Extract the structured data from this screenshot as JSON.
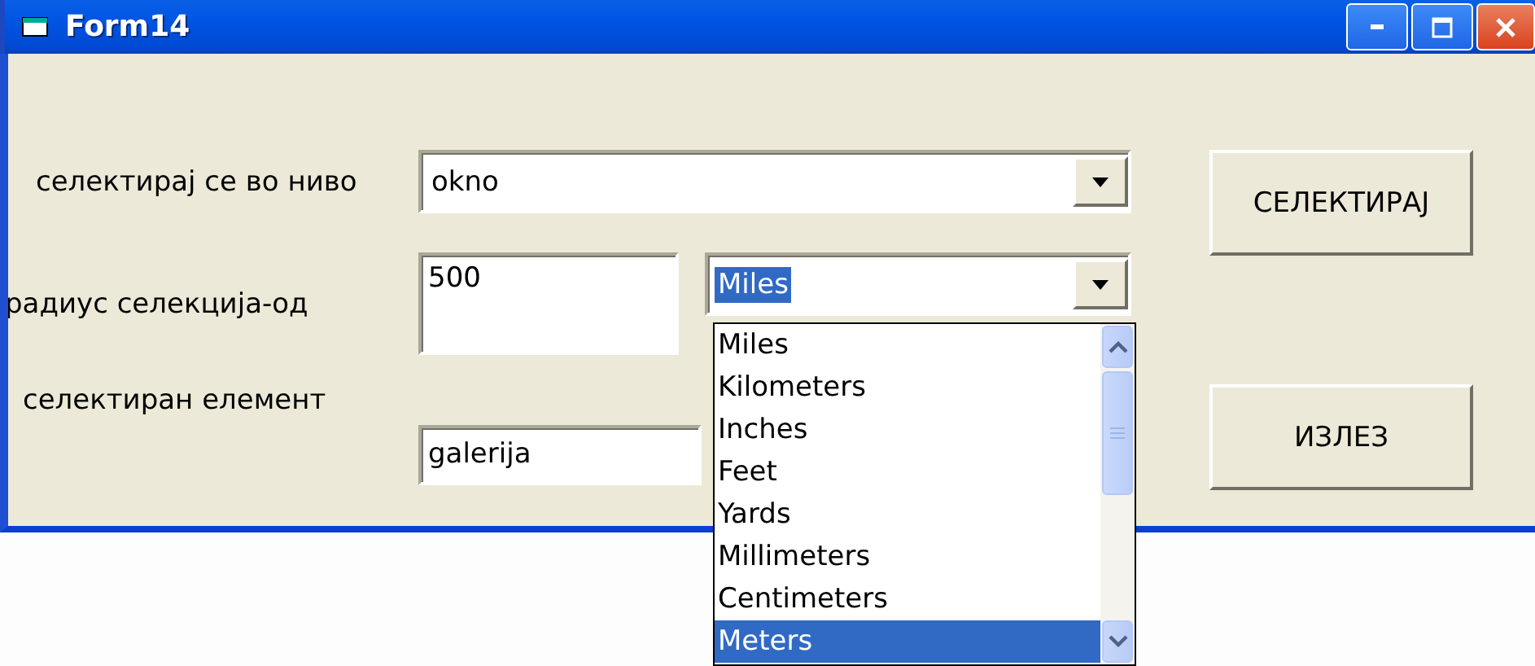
{
  "window": {
    "title": "Form14"
  },
  "rows": [
    {
      "label": "селектирај се во ниво",
      "controls": [
        {
          "kind": "combo",
          "value": "okno",
          "value_highlighted": false
        }
      ]
    },
    {
      "label": "радиус селекција-од",
      "controls": [
        {
          "kind": "textbox",
          "value": "500"
        },
        {
          "kind": "combo",
          "value": "Miles",
          "value_highlighted": true
        }
      ]
    },
    {
      "label": "селектиран елемент",
      "controls": [
        {
          "kind": "textbox",
          "value": "galerija"
        }
      ]
    }
  ],
  "dropdown": {
    "items": [
      {
        "label": "Miles",
        "selected": false
      },
      {
        "label": "Kilometers",
        "selected": false
      },
      {
        "label": "Inches",
        "selected": false
      },
      {
        "label": "Feet",
        "selected": false
      },
      {
        "label": "Yards",
        "selected": false
      },
      {
        "label": "Millimeters",
        "selected": false
      },
      {
        "label": "Centimeters",
        "selected": false
      },
      {
        "label": "Meters",
        "selected": true
      }
    ]
  },
  "buttons": [
    "СЕЛЕКТИРАЈ",
    "ИЗЛЕЗ"
  ]
}
